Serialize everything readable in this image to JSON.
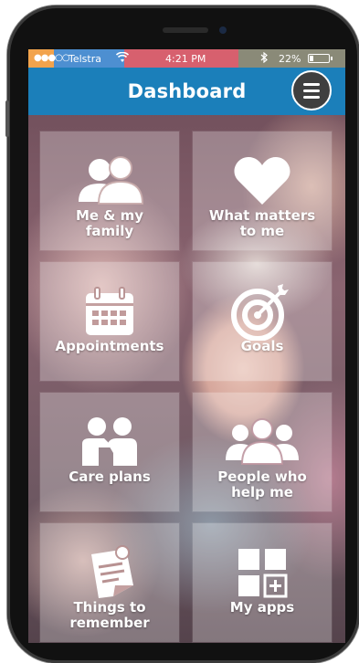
{
  "status_bar": {
    "signal": "●●●○○",
    "carrier": "Telstra",
    "time": "4:21 PM",
    "battery": "22%",
    "battery_level": 0.22
  },
  "header": {
    "title": "Dashboard"
  },
  "tiles": [
    {
      "label_lines": [
        "Me & my",
        "family"
      ],
      "icon": "family-icon"
    },
    {
      "label_lines": [
        "What matters",
        "to me"
      ],
      "icon": "heart-icon"
    },
    {
      "label_lines": [
        "Appointments"
      ],
      "icon": "calendar-icon"
    },
    {
      "label_lines": [
        "Goals"
      ],
      "icon": "target-icon"
    },
    {
      "label_lines": [
        "Care plans"
      ],
      "icon": "care-plans-icon"
    },
    {
      "label_lines": [
        "People who",
        "help me"
      ],
      "icon": "people-icon"
    },
    {
      "label_lines": [
        "Things to",
        "remember"
      ],
      "icon": "note-icon"
    },
    {
      "label_lines": [
        "My apps"
      ],
      "icon": "apps-icon"
    }
  ],
  "colors": {
    "header_blue": "#1b7fba",
    "menu_button": "#3f3f3f"
  }
}
